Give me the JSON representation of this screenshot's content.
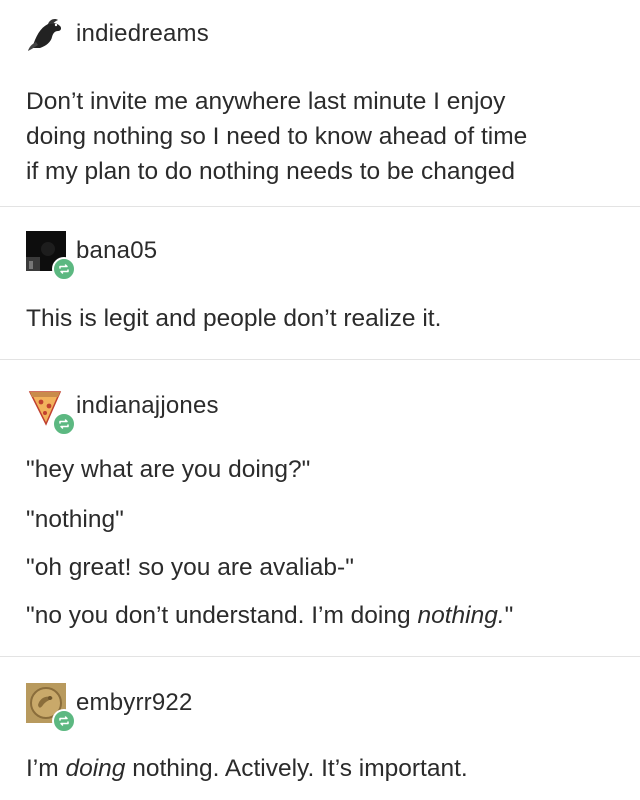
{
  "posts": [
    {
      "username": "indiedreams",
      "avatar_icon": "bird-silhouette-avatar",
      "reblog": false,
      "lines": [
        "Don’t invite me anywhere last minute I enjoy",
        "doing nothing so I need to know ahead of time",
        "if my plan to do nothing needs to be changed"
      ]
    },
    {
      "username": "bana05",
      "avatar_icon": "dark-photo-avatar",
      "reblog": true,
      "lines": [
        "This is legit and people don’t realize it."
      ]
    },
    {
      "username": "indianajjones",
      "avatar_icon": "pizza-slice-avatar",
      "reblog": true,
      "lines": [
        "\"hey what are you doing?\"",
        "\"nothing\"",
        "\"oh great! so you are avaliab-\""
      ],
      "last_line": {
        "before": "\"no you don’t understand. I’m doing ",
        "italic": "nothing.",
        "after": "\""
      }
    },
    {
      "username": "embyrr922",
      "avatar_icon": "gold-coin-avatar",
      "reblog": true,
      "line": {
        "before": "I’m ",
        "italic": "doing",
        "after": " nothing. Actively. It’s important."
      }
    }
  ],
  "colors": {
    "text": "#2b2b2b",
    "divider": "#e3e3e3",
    "reblog_badge": "#5cb881",
    "background": "#ffffff"
  }
}
